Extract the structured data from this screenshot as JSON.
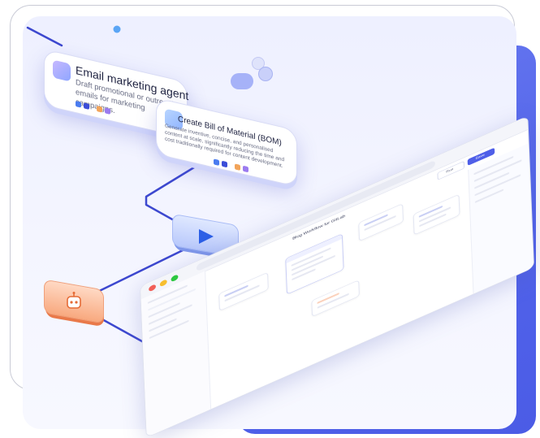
{
  "cards": {
    "email": {
      "title": "Email marketing agent",
      "desc": "Draft promotional or outreach emails for marketing campaigns.",
      "icon": "sparkle-icon"
    },
    "bom": {
      "title": "Create Bill of Material (BOM)",
      "desc": "Generate inventive, concise, and personalised content at scale, significantly reducing the time and cost traditionally required for content development.",
      "icon": "document-icon"
    }
  },
  "tiles": {
    "play": {
      "icon": "play-icon"
    },
    "bot": {
      "icon": "robot-icon"
    }
  },
  "browser": {
    "canvas_title": "Blog Workflow for GitLab",
    "buttons": {
      "run": "Run",
      "save": "Save"
    }
  },
  "colors": {
    "accent": "#4f5fe8",
    "backdrop": "#5a6aed",
    "connector": "#3d48cf",
    "orange": "#f08a5a"
  }
}
